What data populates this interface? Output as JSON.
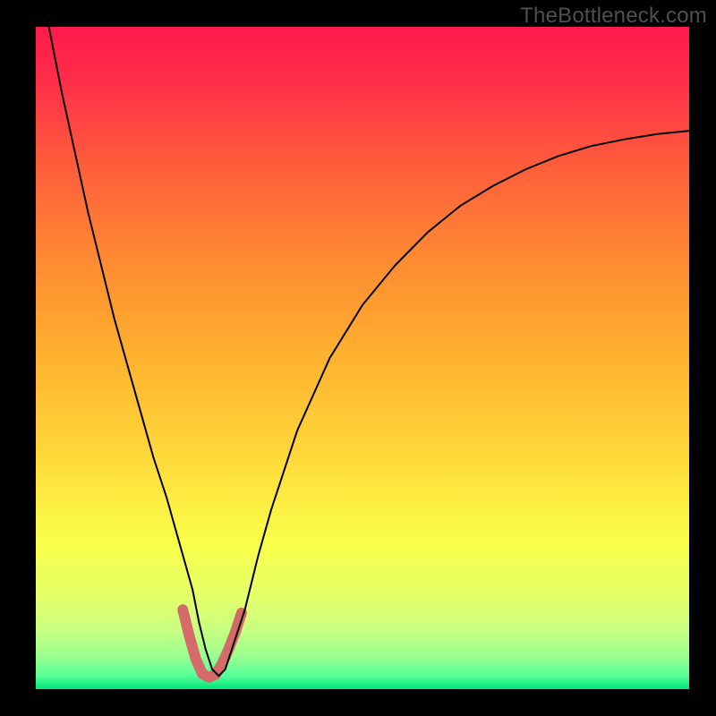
{
  "watermark": "TheBottleneck.com",
  "chart_data": {
    "type": "line",
    "title": "",
    "xlabel": "",
    "ylabel": "",
    "xlim": [
      0,
      100
    ],
    "ylim": [
      0,
      100
    ],
    "grid": false,
    "legend": false,
    "background_gradient_stops": [
      {
        "pct": 0,
        "color": "#ff1a4b"
      },
      {
        "pct": 8,
        "color": "#ff2d4a"
      },
      {
        "pct": 20,
        "color": "#ff5a3c"
      },
      {
        "pct": 35,
        "color": "#ff8a32"
      },
      {
        "pct": 50,
        "color": "#ffb22f"
      },
      {
        "pct": 65,
        "color": "#ffd93a"
      },
      {
        "pct": 78,
        "color": "#f9ff4a"
      },
      {
        "pct": 86,
        "color": "#e5ff6a"
      },
      {
        "pct": 91,
        "color": "#c8ff80"
      },
      {
        "pct": 95,
        "color": "#9bff8f"
      },
      {
        "pct": 98,
        "color": "#55ff99"
      },
      {
        "pct": 100,
        "color": "#00e47a"
      }
    ],
    "series": [
      {
        "name": "bottleneck-curve",
        "color": "#000000",
        "width": 2,
        "x": [
          0,
          2,
          4,
          6,
          8,
          10,
          12,
          14,
          16,
          18,
          20,
          22,
          24,
          25,
          26,
          27,
          28,
          29,
          30,
          32,
          34,
          36,
          40,
          45,
          50,
          55,
          60,
          65,
          70,
          75,
          80,
          85,
          90,
          95,
          100
        ],
        "y": [
          110,
          100,
          90,
          81,
          72,
          64,
          56,
          49,
          42,
          35,
          29,
          22,
          15,
          10,
          6,
          3,
          2,
          3,
          6,
          12,
          20,
          27,
          39,
          50,
          58,
          64,
          69,
          73,
          76,
          78.5,
          80.5,
          82,
          83,
          83.8,
          84.3
        ]
      },
      {
        "name": "trough-marker",
        "color": "#d46a6a",
        "width": 12,
        "linecap": "round",
        "x": [
          22.5,
          23.5,
          24.5,
          25.5,
          26.5,
          27.5,
          28.5,
          29.5,
          30.5,
          31.5
        ],
        "y": [
          12,
          8,
          4.5,
          2.3,
          1.8,
          2.2,
          3.8,
          6.0,
          8.5,
          11.5
        ]
      }
    ]
  }
}
